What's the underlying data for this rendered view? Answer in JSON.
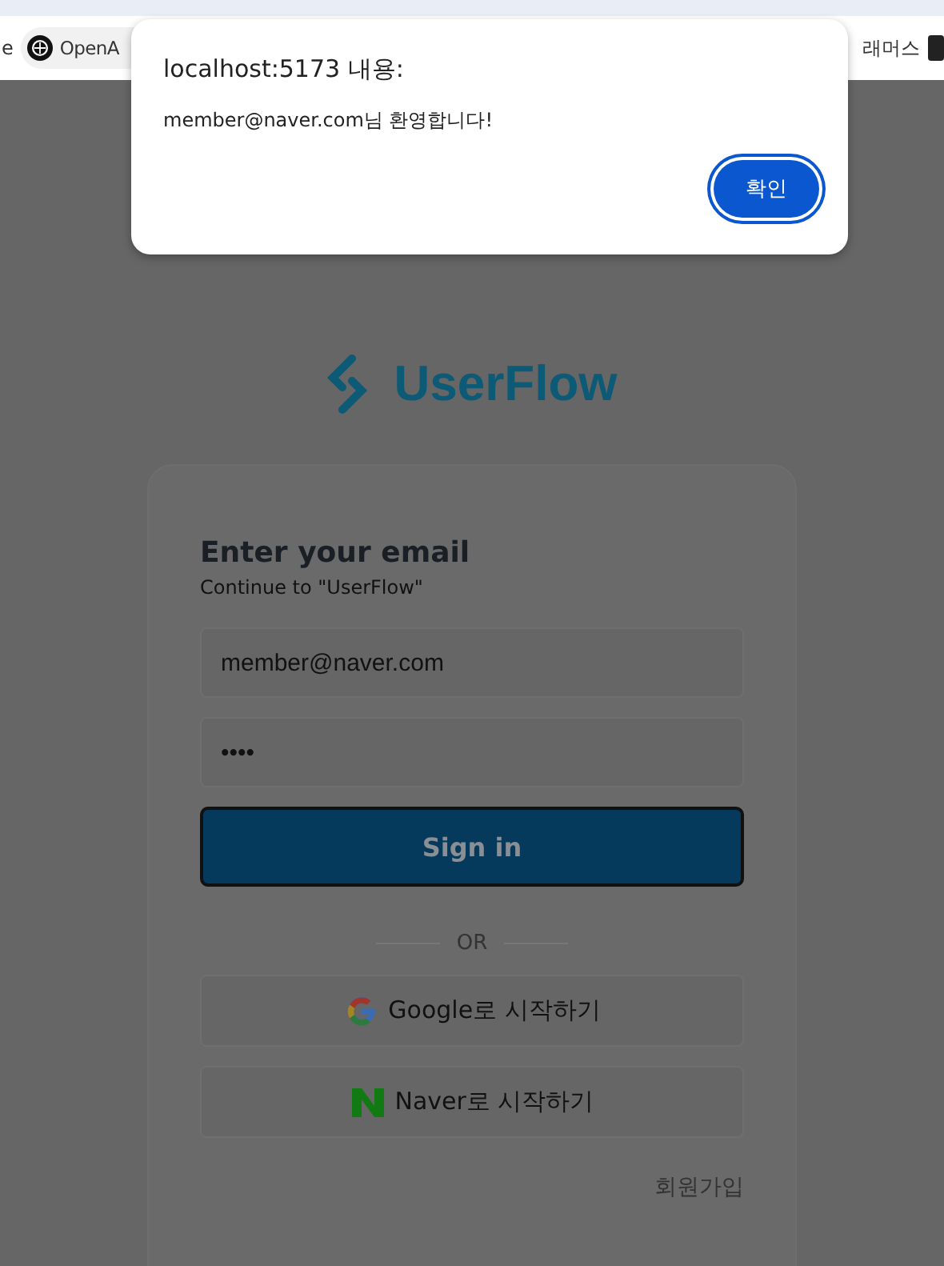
{
  "bookmarks_bar": {
    "items": [
      {
        "label": "e",
        "kind": "plain"
      },
      {
        "label": "OpenA",
        "kind": "chip"
      },
      {
        "label": "래머스",
        "kind": "plain"
      }
    ]
  },
  "alert_dialog": {
    "title": "localhost:5173 내용:",
    "message": "member@naver.com님 환영합니다!",
    "button": "확인"
  },
  "page": {
    "logo": "UserFlow",
    "heading": "Enter your email",
    "subheading": "Continue to \"UserFlow\"",
    "email": {
      "value": "member@naver.com"
    },
    "password": {
      "value": "••••"
    },
    "sign_in_button": "Sign in",
    "divider": "OR",
    "social_buttons": [
      {
        "label": "Google로 시작하기",
        "kind": "google"
      },
      {
        "label": "Naver로 시작하기",
        "kind": "naver"
      }
    ],
    "signup_link": "회원가입"
  }
}
